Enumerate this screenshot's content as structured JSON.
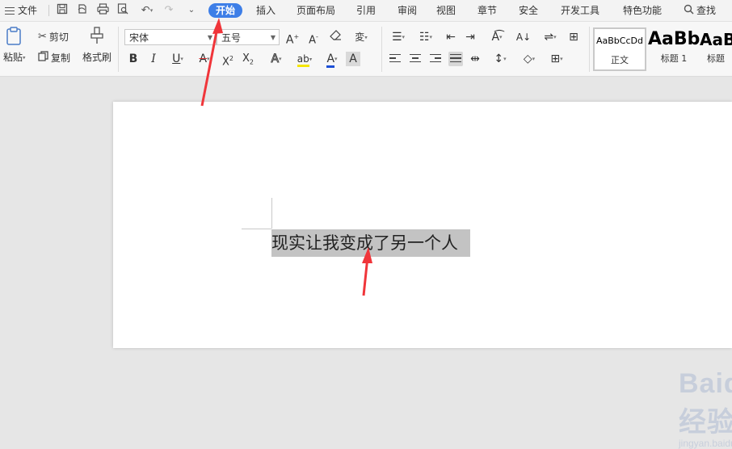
{
  "menubar": {
    "file_label": "文件",
    "tabs": [
      "开始",
      "插入",
      "页面布局",
      "引用",
      "审阅",
      "视图",
      "章节",
      "安全",
      "开发工具",
      "特色功能"
    ],
    "active_tab": "开始",
    "search_label": "查找"
  },
  "ribbon": {
    "paste_label": "粘贴",
    "cut_label": "剪切",
    "copy_label": "复制",
    "format_painter_label": "格式刷",
    "font_name": "宋体",
    "font_size": "五号",
    "styles": [
      {
        "sample": "AaBbCcDd",
        "name": "正文"
      },
      {
        "sample": "AaBb",
        "name": "标题 1"
      },
      {
        "sample": "AaB",
        "name": "标题"
      }
    ]
  },
  "document": {
    "text": "现实让我变成了另一个人"
  },
  "watermark": {
    "logo": "Baidu经验",
    "url": "jingyan.baidu.com"
  },
  "colors": {
    "accent": "#3d7ee7",
    "annotation_arrow": "#f0353a",
    "selection": "#c3c3c3",
    "highlight_yellow": "#f5e600",
    "font_color_blue": "#1c4fd6"
  }
}
